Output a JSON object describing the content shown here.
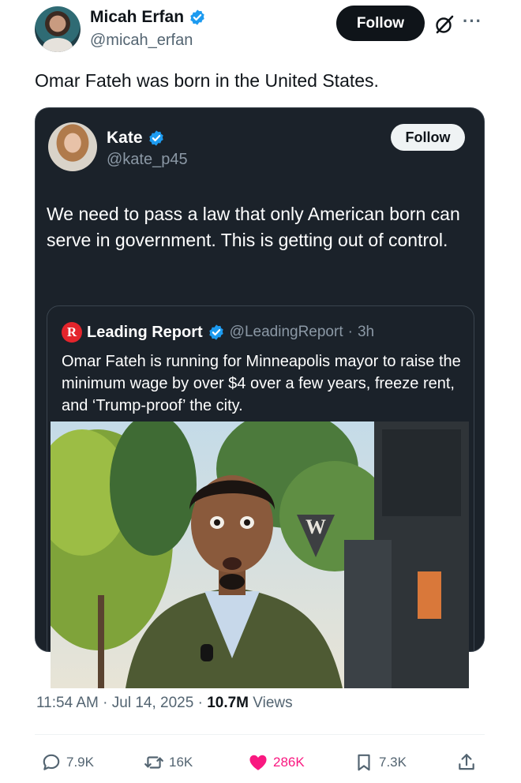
{
  "post": {
    "author_name": "Micah Erfan",
    "author_handle": "@micah_erfan",
    "follow_label": "Follow",
    "more_label": "···",
    "text": "Omar Fateh was born in the United States.",
    "time": "11:54 AM",
    "date": "Jul 14, 2025",
    "views_count": "10.7M",
    "views_label": "Views",
    "separator": "·"
  },
  "quoted": {
    "author_name": "Kate",
    "author_handle": "@kate_p45",
    "follow_label": "Follow",
    "text": "We need to pass a law that only American born can serve in government. This is getting out of control."
  },
  "nested_quote": {
    "logo_letter": "R",
    "author_name": "Leading Report",
    "author_handle": "@LeadingReport",
    "age": "3h",
    "text": "Omar Fateh is running for Minneapolis mayor to raise the minimum wage by over $4 over a few years, freeze rent, and ‘Trump-proof’ the city.",
    "photo_sign": "W"
  },
  "actions": {
    "replies": "7.9K",
    "reposts": "16K",
    "likes": "286K",
    "bookmarks": "7.3K"
  },
  "colors": {
    "verified": "#1d9bf0",
    "like": "#f91880",
    "card_bg": "#1b222a",
    "leading_report_red": "#e4252c"
  }
}
